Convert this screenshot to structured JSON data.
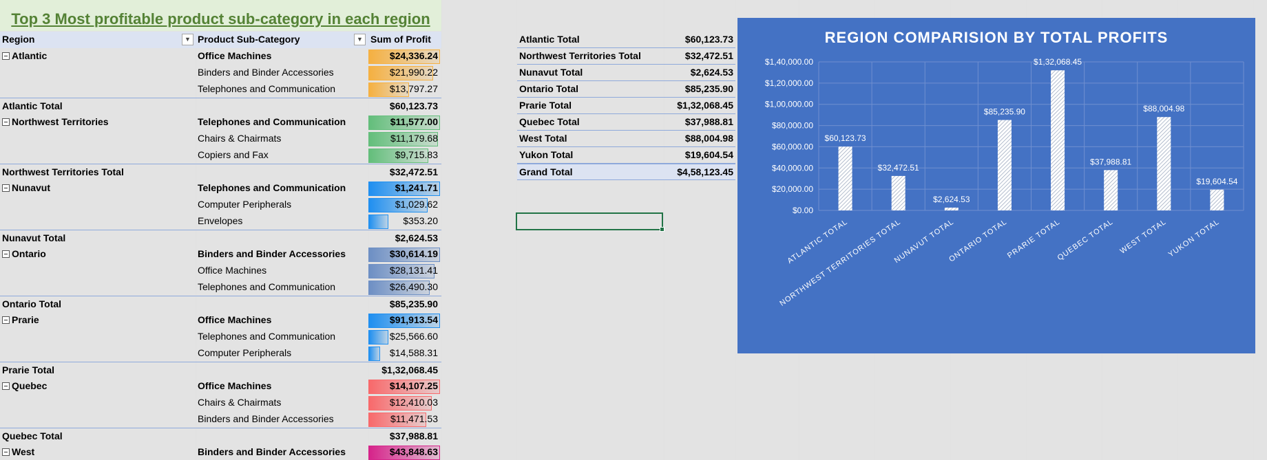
{
  "title": "Top 3 Most profitable product sub-category in each region",
  "pivot": {
    "headers": {
      "region": "Region",
      "subcategory": "Product Sub-Category",
      "profit": "Sum of Profit"
    },
    "rows": [
      {
        "kind": "region",
        "c1": "Atlantic",
        "c2": "Office Machines",
        "c3": "$24,336.24",
        "fill": 1.0,
        "color": "#f5b041"
      },
      {
        "kind": "item",
        "c1": "",
        "c2": "Binders and Binder Accessories",
        "c3": "$21,990.22",
        "fill": 0.9,
        "color": "#f5b041"
      },
      {
        "kind": "item",
        "c1": "",
        "c2": "Telephones and Communication",
        "c3": "$13,797.27",
        "fill": 0.57,
        "color": "#f5b041"
      },
      {
        "kind": "total",
        "c1": "Atlantic Total",
        "c2": "",
        "c3": "$60,123.73"
      },
      {
        "kind": "region",
        "c1": "Northwest Territories",
        "c2": "Telephones and Communication",
        "c3": "$11,577.00",
        "fill": 1.0,
        "color": "#63be7b"
      },
      {
        "kind": "item",
        "c1": "",
        "c2": "Chairs & Chairmats",
        "c3": "$11,179.68",
        "fill": 0.97,
        "color": "#63be7b"
      },
      {
        "kind": "item",
        "c1": "",
        "c2": "Copiers and Fax",
        "c3": "$9,715.83",
        "fill": 0.84,
        "color": "#63be7b"
      },
      {
        "kind": "total",
        "c1": "Northwest Territories Total",
        "c2": "",
        "c3": "$32,472.51"
      },
      {
        "kind": "region",
        "c1": "Nunavut",
        "c2": "Telephones and Communication",
        "c3": "$1,241.71",
        "fill": 1.0,
        "color": "#1f8ff0"
      },
      {
        "kind": "item",
        "c1": "",
        "c2": "Computer Peripherals",
        "c3": "$1,029.62",
        "fill": 0.83,
        "color": "#1f8ff0"
      },
      {
        "kind": "item",
        "c1": "",
        "c2": "Envelopes",
        "c3": "$353.20",
        "fill": 0.28,
        "color": "#1f8ff0"
      },
      {
        "kind": "total",
        "c1": "Nunavut Total",
        "c2": "",
        "c3": "$2,624.53"
      },
      {
        "kind": "region",
        "c1": "Ontario",
        "c2": "Binders and Binder Accessories",
        "c3": "$30,614.19",
        "fill": 1.0,
        "color": "#6d8fc4"
      },
      {
        "kind": "item",
        "c1": "",
        "c2": "Office Machines",
        "c3": "$28,131.41",
        "fill": 0.92,
        "color": "#6d8fc4"
      },
      {
        "kind": "item",
        "c1": "",
        "c2": "Telephones and Communication",
        "c3": "$26,490.30",
        "fill": 0.86,
        "color": "#6d8fc4"
      },
      {
        "kind": "total",
        "c1": "Ontario Total",
        "c2": "",
        "c3": "$85,235.90"
      },
      {
        "kind": "region",
        "c1": "Prarie",
        "c2": "Office Machines",
        "c3": "$91,913.54",
        "fill": 1.0,
        "color": "#1f8ff0"
      },
      {
        "kind": "item",
        "c1": "",
        "c2": "Telephones and Communication",
        "c3": "$25,566.60",
        "fill": 0.28,
        "color": "#1f8ff0"
      },
      {
        "kind": "item",
        "c1": "",
        "c2": "Computer Peripherals",
        "c3": "$14,588.31",
        "fill": 0.16,
        "color": "#1f8ff0"
      },
      {
        "kind": "total",
        "c1": "Prarie Total",
        "c2": "",
        "c3": "$1,32,068.45"
      },
      {
        "kind": "region",
        "c1": "Quebec",
        "c2": "Office Machines",
        "c3": "$14,107.25",
        "fill": 1.0,
        "color": "#f8696b"
      },
      {
        "kind": "item",
        "c1": "",
        "c2": "Chairs & Chairmats",
        "c3": "$12,410.03",
        "fill": 0.88,
        "color": "#f8696b"
      },
      {
        "kind": "item",
        "c1": "",
        "c2": "Binders and Binder Accessories",
        "c3": "$11,471.53",
        "fill": 0.81,
        "color": "#f8696b"
      },
      {
        "kind": "total",
        "c1": "Quebec Total",
        "c2": "",
        "c3": "$37,988.81"
      },
      {
        "kind": "region",
        "c1": "West",
        "c2": "Binders and Binder Accessories",
        "c3": "$43,848.63",
        "fill": 1.0,
        "color": "#d6238a"
      }
    ]
  },
  "summary": {
    "rows": [
      {
        "label": "Atlantic Total",
        "value": "$60,123.73"
      },
      {
        "label": "Northwest Territories Total",
        "value": "$32,472.51"
      },
      {
        "label": "Nunavut Total",
        "value": "$2,624.53"
      },
      {
        "label": "Ontario Total",
        "value": "$85,235.90"
      },
      {
        "label": "Prarie Total",
        "value": "$1,32,068.45"
      },
      {
        "label": "Quebec Total",
        "value": "$37,988.81"
      },
      {
        "label": "West Total",
        "value": "$88,004.98"
      },
      {
        "label": "Yukon Total",
        "value": "$19,604.54"
      }
    ],
    "grand": {
      "label": "Grand Total",
      "value": "$4,58,123.45"
    }
  },
  "chart_data": {
    "type": "bar",
    "title": "REGION COMPARISION BY TOTAL PROFITS",
    "categories": [
      "ATLANTIC TOTAL",
      "NORTHWEST TERRITORIES TOTAL",
      "NUNAVUT TOTAL",
      "ONTARIO TOTAL",
      "PRARIE TOTAL",
      "QUEBEC TOTAL",
      "WEST TOTAL",
      "YUKON TOTAL"
    ],
    "values": [
      60123.73,
      32472.51,
      2624.53,
      85235.9,
      132068.45,
      37988.81,
      88004.98,
      19604.54
    ],
    "data_labels": [
      "$60,123.73",
      "$32,472.51",
      "$2,624.53",
      "$85,235.90",
      "$1,32,068.45",
      "$37,988.81",
      "$88,004.98",
      "$19,604.54"
    ],
    "y_ticks": [
      0,
      20000,
      40000,
      60000,
      80000,
      100000,
      120000,
      140000
    ],
    "y_tick_labels": [
      "$0.00",
      "$20,000.00",
      "$40,000.00",
      "$60,000.00",
      "$80,000.00",
      "$1,00,000.00",
      "$1,20,000.00",
      "$1,40,000.00"
    ],
    "ylim": [
      0,
      140000
    ],
    "grid": true,
    "bar_pattern": "diagonal-hatch",
    "background": "#4472c4",
    "bar_color": "#ffffff"
  }
}
